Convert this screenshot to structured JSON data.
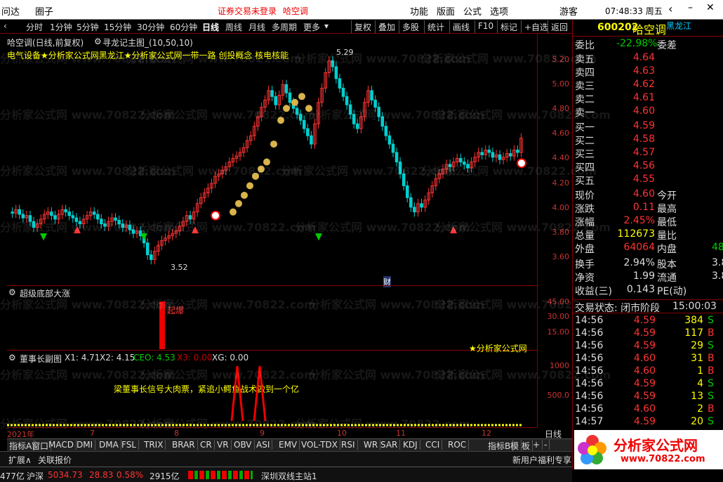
{
  "topbar": {
    "app": "问达",
    "circle": "圈子",
    "login_status": "证券交易未登录",
    "stock_name": "哈空调",
    "menu": [
      "功能",
      "版面",
      "公式",
      "选项"
    ],
    "user": "游客",
    "clock": "07:48:33 周五"
  },
  "toolbar": {
    "periods": [
      "分时",
      "1分钟",
      "5分钟",
      "15分钟",
      "30分钟",
      "60分钟",
      "日线",
      "周线",
      "月线",
      "多周期",
      "更多"
    ],
    "buttons": [
      "复权",
      "叠加",
      "多股",
      "统计",
      "画线",
      "F10",
      "标记",
      "+自选",
      "返回"
    ]
  },
  "chart": {
    "title": "哈空调(日线,前复权)",
    "indicator_name": "寻龙记主图_(10,50,10)",
    "concept_line": "电气设备★分析家公式网黑龙江★分析家公式网一带一路 创投概念 核电核能",
    "high_label": "5.29",
    "low_label": "3.52",
    "tag": "财",
    "y_ticks": [
      "5.20",
      "5.00",
      "4.80",
      "4.60",
      "4.40",
      "4.20",
      "4.00",
      "3.80",
      "3.60"
    ]
  },
  "ind1": {
    "title": "超级底部大涨",
    "label": "起爆",
    "ticks": [
      "45.00",
      "30.00",
      "15.00"
    ]
  },
  "ind2": {
    "title": "董事长副图",
    "x1": "X1: 4.71",
    "x2": "X2: 4.15",
    "ceo": "CEO: 4.53",
    "x3": "X3: 0.00",
    "xg": "XG: 0.00",
    "message": "梁董事长信号大肉票，紧追小鳄鱼战术做到一个亿",
    "site": "★分析家公式网",
    "ticks": [
      "1000",
      "500.0"
    ]
  },
  "dates": [
    "2021年",
    "7",
    "8",
    "9",
    "10",
    "11",
    "12"
  ],
  "period_label": "日线",
  "tabs": [
    "指标A",
    "窗口",
    "MACD",
    "DMI",
    "DMA",
    "FSL",
    "TRIX",
    "BRAR",
    "CR",
    "VR",
    "OBV",
    "ASI",
    "EMV",
    "VOL-TDX",
    "RSI",
    "WR",
    "SAR",
    "KDJ",
    "CCI",
    "ROC",
    "指标B",
    "模",
    "板",
    "+",
    "-"
  ],
  "bottom": {
    "expand": "扩展∧",
    "related": "关联报价",
    "notice": "新用户福利专享"
  },
  "status": {
    "amount1": "477亿",
    "index_name": "沪深",
    "index_value": "5034.73",
    "change": "28.83",
    "pct": "0.58%",
    "amount2": "2915亿",
    "server": "深圳双线主站1"
  },
  "quote": {
    "code": "600202",
    "name": "哈空调",
    "region": "黑龙江",
    "webi_label": "委比",
    "webi": "-22.98%",
    "weicha_label": "委差",
    "asks": [
      {
        "label": "卖五",
        "price": "4.64"
      },
      {
        "label": "卖四",
        "price": "4.63"
      },
      {
        "label": "卖三",
        "price": "4.62"
      },
      {
        "label": "卖二",
        "price": "4.61"
      },
      {
        "label": "卖一",
        "price": "4.60"
      }
    ],
    "bids": [
      {
        "label": "买一",
        "price": "4.59"
      },
      {
        "label": "买二",
        "price": "4.58"
      },
      {
        "label": "买三",
        "price": "4.57"
      },
      {
        "label": "买四",
        "price": "4.56"
      },
      {
        "label": "买五",
        "price": "4.55"
      }
    ],
    "stats": [
      {
        "l": "现价",
        "v": "4.60",
        "r": "今开"
      },
      {
        "l": "涨跌",
        "v": "0.11",
        "r": "最高"
      },
      {
        "l": "涨幅",
        "v": "2.45%",
        "r": "最低"
      },
      {
        "l": "总量",
        "v": "112673",
        "r": "量比"
      },
      {
        "l": "外盘",
        "v": "64064",
        "r": "内盘",
        "rv": "48"
      }
    ],
    "stats2": [
      {
        "l": "换手",
        "v": "2.94%",
        "r": "股本",
        "rv": "3.8"
      },
      {
        "l": "净资",
        "v": "1.99",
        "r": "流通",
        "rv": "3.8"
      },
      {
        "l": "收益(三)",
        "v": "0.143",
        "r": "PE(动)"
      }
    ],
    "trade_state": "交易状态: 闭市阶段",
    "trade_time": "15:00:03",
    "ticks": [
      {
        "t": "14:56",
        "p": "4.59",
        "v": "384",
        "s": "S"
      },
      {
        "t": "14:56",
        "p": "4.59",
        "v": "117",
        "s": "B"
      },
      {
        "t": "14:56",
        "p": "4.59",
        "v": "29",
        "s": "S"
      },
      {
        "t": "14:56",
        "p": "4.60",
        "v": "31",
        "s": "B"
      },
      {
        "t": "14:56",
        "p": "4.60",
        "v": "1",
        "s": "B"
      },
      {
        "t": "14:56",
        "p": "4.59",
        "v": "4",
        "s": "S"
      },
      {
        "t": "14:56",
        "p": "4.59",
        "v": "13",
        "s": "S"
      },
      {
        "t": "14:56",
        "p": "4.60",
        "v": "2",
        "s": "B"
      },
      {
        "t": "14:57",
        "p": "4.59",
        "v": "20",
        "s": "S"
      }
    ]
  },
  "logo": {
    "text": "分析家公式网",
    "url": "www.70822.com"
  },
  "watermark": "分析家公式网 www.70822.com",
  "colors": {
    "up": "#ff3333",
    "down": "#00d0d0",
    "bg": "#000000",
    "border": "#880000"
  }
}
